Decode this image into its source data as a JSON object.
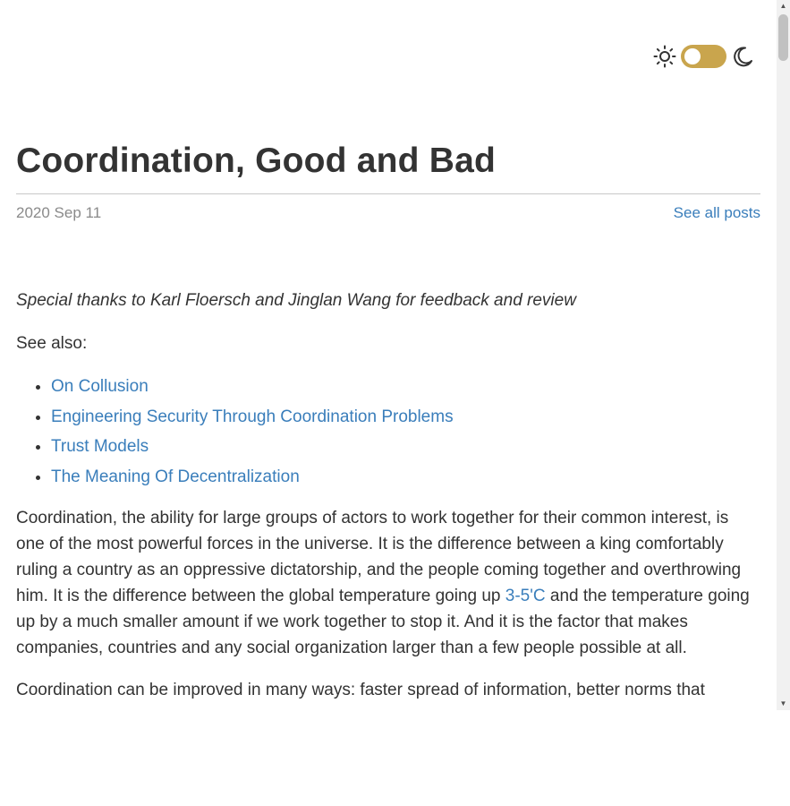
{
  "theme_toggle": {
    "light_icon": "sun-icon",
    "dark_icon": "moon-icon",
    "accent_color": "#c9a54d"
  },
  "post": {
    "title": "Coordination, Good and Bad",
    "date": "2020 Sep 11",
    "see_all_label": "See all posts",
    "thanks": "Special thanks to Karl Floersch and Jinglan Wang for feedback and review",
    "see_also_label": "See also:",
    "see_also_links": [
      "On Collusion",
      "Engineering Security Through Coordination Problems",
      "Trust Models",
      "The Meaning Of Decentralization"
    ],
    "para1": {
      "before_link": "Coordination, the ability for large groups of actors to work together for their common interest, is one of the most powerful forces in the universe. It is the difference between a king comfortably ruling a country as an oppressive dictatorship, and the people coming together and overthrowing him. It is the difference between the global temperature going up ",
      "link": "3-5'C",
      "after_link": " and the temperature going up by a much smaller amount if we work together to stop it. And it is the factor that makes companies, countries and any social organization larger than a few people possible at all."
    },
    "para2": "Coordination can be improved in many ways: faster spread of information, better norms that"
  },
  "colors": {
    "link": "#3a7ebb",
    "text": "#333333",
    "date": "#8a8a8a"
  }
}
